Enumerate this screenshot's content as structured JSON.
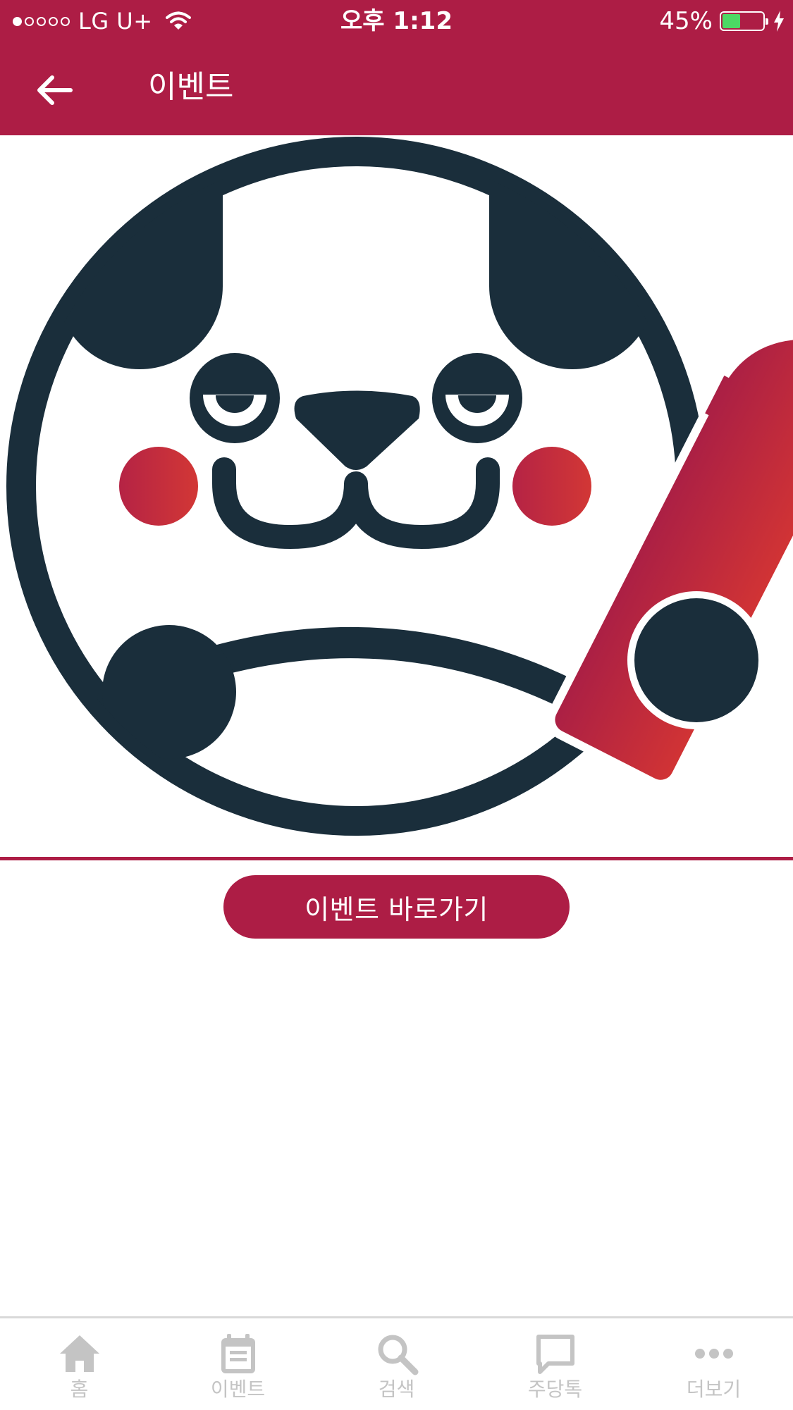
{
  "status_bar": {
    "carrier": "LG U+",
    "time": "오후 1:12",
    "battery": "45%",
    "battery_level": 0.45
  },
  "header": {
    "title": "이벤트",
    "back_icon": "arrow-left-icon"
  },
  "main": {
    "banner_image": "drunk-dog-with-wine-bottle-logo",
    "button_label": "이벤트 바로가기"
  },
  "tab_bar": {
    "items": [
      {
        "label": "홈",
        "icon": "home-icon"
      },
      {
        "label": "이벤트",
        "icon": "calendar-icon"
      },
      {
        "label": "검색",
        "icon": "search-icon"
      },
      {
        "label": "주당톡",
        "icon": "chat-icon"
      },
      {
        "label": "더보기",
        "icon": "more-icon"
      }
    ]
  },
  "colors": {
    "primary": "#ad1d45",
    "logo_dark": "#1a2e3b",
    "cheek_red": "#cd3236",
    "tab_inactive": "#c4c4c4"
  }
}
